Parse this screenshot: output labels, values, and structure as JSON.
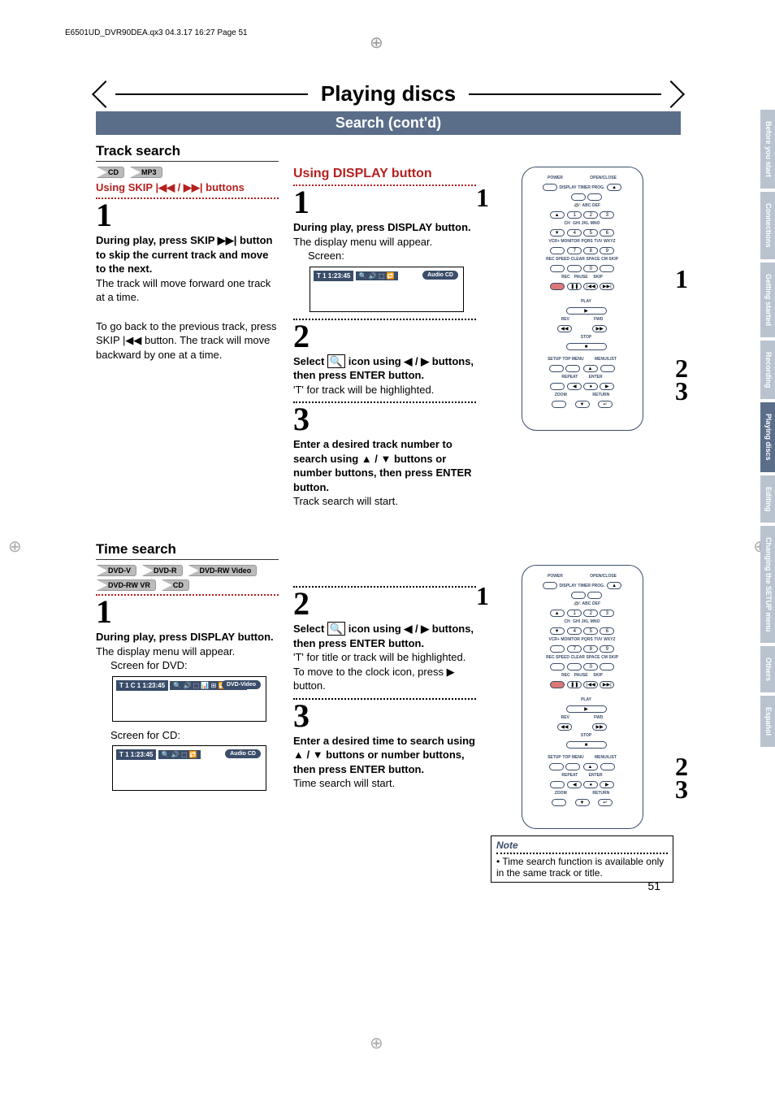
{
  "header_line": "E6501UD_DVR90DEA.qx3  04.3.17  16:27  Page 51",
  "main_title": "Playing discs",
  "sub_title": "Search (cont'd)",
  "track_search": {
    "heading": "Track search",
    "badges": [
      "CD",
      "MP3"
    ],
    "using_skip": "Using SKIP |◀◀ / ▶▶| buttons",
    "step1_num": "1",
    "step1_bold": "During play, press SKIP ▶▶| button to skip the current track and move to the next.",
    "step1_text": "The track will move forward one track at a time.",
    "step1_para2": "To go back to the previous track, press SKIP |◀◀ button. The track will move backward by one at a time."
  },
  "display": {
    "heading": "Using DISPLAY button",
    "step1_num": "1",
    "step1_bold": "During play, press DISPLAY button.",
    "step1_text": "The display menu will appear.",
    "step1_sub": "Screen:",
    "screen_info": "T   1       1:23:45",
    "screen_tag": "Audio CD",
    "step2_num": "2",
    "step2_text1": "Select ",
    "step2_text2": " icon using ◀ / ▶ buttons, then press ENTER button.",
    "step2_sub": "'T' for track will be highlighted.",
    "step3_num": "3",
    "step3_bold": "Enter a desired track number to search using ▲ / ▼ buttons or number buttons, then press ENTER button.",
    "step3_text": "Track search will start."
  },
  "remote_callouts_1": {
    "c1": "1",
    "c1b": "1",
    "c2": "2",
    "c3": "3"
  },
  "time_search": {
    "heading": "Time search",
    "badges_row1": [
      "DVD-V",
      "DVD-R",
      "DVD-RW Video"
    ],
    "badges_row2": [
      "DVD-RW VR",
      "CD"
    ],
    "step1_num": "1",
    "step1_bold": "During play, press DISPLAY button.",
    "step1_text": "The display menu will appear.",
    "step1_sub1": "Screen for DVD:",
    "screen1_info": "T   1  C   1      1:23:45",
    "screen1_tag": "DVD-Video",
    "step1_sub2": "Screen for CD:",
    "screen2_info": "T   1       1:23:45",
    "screen2_tag": "Audio CD",
    "step2_num": "2",
    "step2_text1": "Select ",
    "step2_text2": " icon using ◀ / ▶ buttons, then press ENTER button.",
    "step2_sub": "'T' for title or track will be highlighted.",
    "step2_sub2": "To move to the clock icon, press ▶ button.",
    "step3_num": "3",
    "step3_bold": "Enter a desired time to search using ▲ / ▼ buttons or number buttons, then press ENTER button.",
    "step3_text": "Time search will start."
  },
  "remote_callouts_2": {
    "c1": "1",
    "c2": "2",
    "c3": "3"
  },
  "note": {
    "title": "Note",
    "text": "• Time search function is available only in the same track or title."
  },
  "side_tabs": [
    "Before you start",
    "Connections",
    "Getting started",
    "Recording",
    "Playing discs",
    "Editing",
    "Changing the SETUP menu",
    "Others",
    "Español"
  ],
  "active_tab_index": 4,
  "page_number": "51",
  "remote_labels": {
    "power": "POWER",
    "openclose": "OPEN/CLOSE",
    "display": "DISPLAY",
    "timer": "TIMER PROG.",
    "ch": "CH",
    "vcr": "VCR+ MONITOR",
    "abc": "ABC",
    "def": "DEF",
    "ghi": "GHI",
    "jkl": "JKL",
    "mno": "MNO",
    "pqrs": "PQRS",
    "tuv": "TUV",
    "wxyz": "WXYZ",
    "recspeed": "REC SPEED",
    "clear": "CLEAR",
    "space": "SPACE",
    "cmskip": "CM SKIP",
    "rec": "REC",
    "pause": "PAUSE",
    "skip": "SKIP",
    "play": "PLAY",
    "rev": "REV",
    "fwd": "FWD",
    "stop": "STOP",
    "setup": "SETUP",
    "topmenu": "TOP MENU",
    "menulist": "MENU/LIST",
    "repeat": "REPEAT",
    "enter": "ENTER",
    "zoom": "ZOOM",
    "return": "RETURN"
  }
}
